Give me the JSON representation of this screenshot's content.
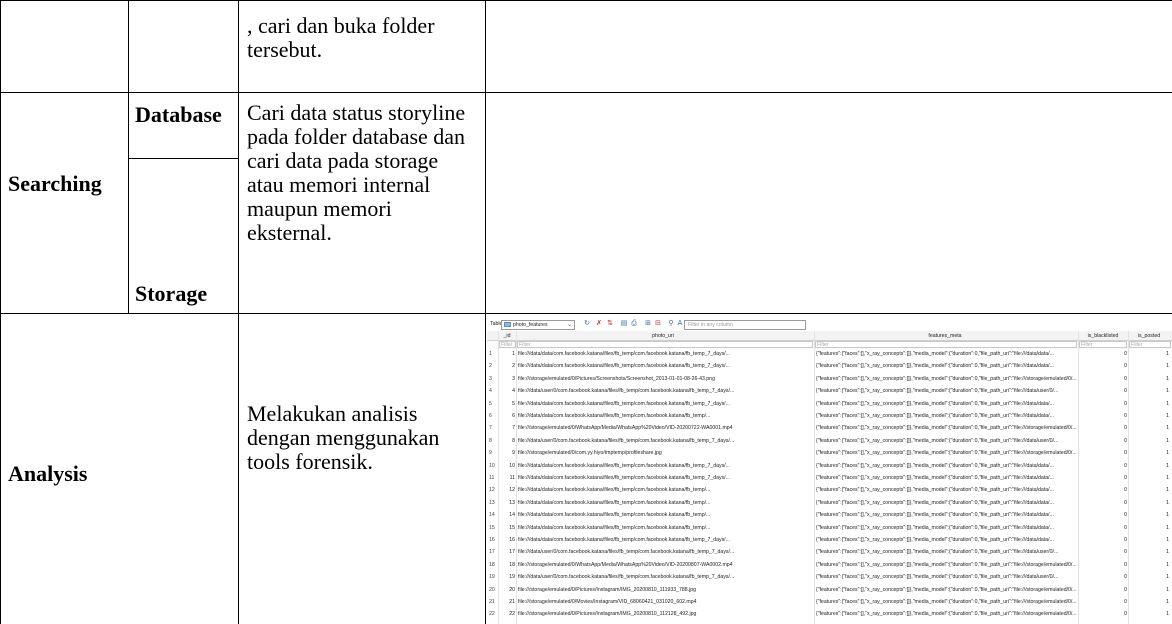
{
  "table": {
    "row1": {
      "col3": ", cari dan buka folder tersebut."
    },
    "row2": {
      "col1": "Searching",
      "sub_database": "Database",
      "sub_storage": "Storage",
      "col3": "Cari data status storyline pada folder database dan cari data pada storage atau memori internal maupun memori eksternal."
    },
    "row3": {
      "col1": "Analysis",
      "col3": "Melakukan analisis dengan menggunakan tools forensik."
    }
  },
  "screenshot": {
    "toolbar": {
      "table_label": "Table:",
      "table_name": "photo_features",
      "filter_placeholder": "Filter in any column"
    },
    "columns": [
      "_id",
      "photo_uri",
      "features_meta",
      "is_blacklisted",
      "is_posted"
    ],
    "filter_label": "Filter",
    "rows": [
      {
        "n": "1",
        "id": "1",
        "uri": "file:///data/data/com.facebook.katana/files/fb_temp/com.facebook.katana/fb_temp_7_days/...",
        "meta": "{\"features\":{\"faces\":[],\"x_ray_concepts\":[]},\"media_model\":{\"duration\":0,\"file_path_uri\":\"file:///data/data/...",
        "bl": "0",
        "po": "1"
      },
      {
        "n": "2",
        "id": "2",
        "uri": "file:///data/data/com.facebook.katana/files/fb_temp/com.facebook.katana/fb_temp_7_days/...",
        "meta": "{\"features\":{\"faces\":[],\"x_ray_concepts\":[]},\"media_model\":{\"duration\":0,\"file_path_uri\":\"file:///data/data/...",
        "bl": "0",
        "po": "1"
      },
      {
        "n": "3",
        "id": "3",
        "uri": "file:///storage/emulated/0/Pictures/Screenshots/Screenshot_2013-01-01-08-26-43.png",
        "meta": "{\"features\":{\"faces\":[],\"x_ray_concepts\":[]},\"media_model\":{\"duration\":0,\"file_path_uri\":\"file:///storage/emulated/0/...",
        "bl": "0",
        "po": "1"
      },
      {
        "n": "4",
        "id": "4",
        "uri": "file:///data/user/0/com.facebook.katana/files/fb_temp/com.facebook.katana/fb_temp_7_days/...",
        "meta": "{\"features\":{\"faces\":[],\"x_ray_concepts\":[]},\"media_model\":{\"duration\":0,\"file_path_uri\":\"file:///data/user/0/...",
        "bl": "0",
        "po": "1"
      },
      {
        "n": "5",
        "id": "5",
        "uri": "file:///data/data/com.facebook.katana/files/fb_temp/com.facebook.katana/fb_temp_7_days/...",
        "meta": "{\"features\":{\"faces\":[],\"x_ray_concepts\":[]},\"media_model\":{\"duration\":0,\"file_path_uri\":\"file:///data/data/...",
        "bl": "0",
        "po": "1"
      },
      {
        "n": "6",
        "id": "6",
        "uri": "file:///data/data/com.facebook.katana/files/fb_temp/com.facebook.katana/fb_temp/...",
        "meta": "{\"features\":{\"faces\":[],\"x_ray_concepts\":[]},\"media_model\":{\"duration\":0,\"file_path_uri\":\"file:///data/data/...",
        "bl": "0",
        "po": "1"
      },
      {
        "n": "7",
        "id": "7",
        "uri": "file:///storage/emulated/0/WhatsApp/Media/WhatsApp%20Video/VID-20200722-WA0001.mp4",
        "meta": "{\"features\":{\"faces\":[],\"x_ray_concepts\":[]},\"media_model\":{\"duration\":0,\"file_path_uri\":\"file:///storage/emulated/0/...",
        "bl": "0",
        "po": "1"
      },
      {
        "n": "8",
        "id": "8",
        "uri": "file:///data/user/0/com.facebook.katana/files/fb_temp/com.facebook.katana/fb_temp_7_days/...",
        "meta": "{\"features\":{\"faces\":[],\"x_ray_concepts\":[]},\"media_model\":{\"duration\":0,\"file_path_uri\":\"file:///data/user/0/...",
        "bl": "0",
        "po": "1"
      },
      {
        "n": "9",
        "id": "9",
        "uri": "file:///storage/emulated/0/com.yy.hiyo/tmptemp/profileshare.jpg",
        "meta": "{\"features\":{\"faces\":[],\"x_ray_concepts\":[]},\"media_model\":{\"duration\":0,\"file_path_uri\":\"file:///storage/emulated/0/...",
        "bl": "0",
        "po": "1"
      },
      {
        "n": "10",
        "id": "10",
        "uri": "file:///data/data/com.facebook.katana/files/fb_temp/com.facebook.katana/fb_temp_7_days/...",
        "meta": "{\"features\":{\"faces\":[],\"x_ray_concepts\":[]},\"media_model\":{\"duration\":0,\"file_path_uri\":\"file:///data/data/...",
        "bl": "0",
        "po": "1"
      },
      {
        "n": "11",
        "id": "11",
        "uri": "file:///data/data/com.facebook.katana/files/fb_temp/com.facebook.katana/fb_temp_7_days/...",
        "meta": "{\"features\":{\"faces\":[],\"x_ray_concepts\":[]},\"media_model\":{\"duration\":0,\"file_path_uri\":\"file:///data/data/...",
        "bl": "0",
        "po": "1"
      },
      {
        "n": "12",
        "id": "12",
        "uri": "file:///data/data/com.facebook.katana/files/fb_temp/com.facebook.katana/fb_temp/...",
        "meta": "{\"features\":{\"faces\":[],\"x_ray_concepts\":[]},\"media_model\":{\"duration\":0,\"file_path_uri\":\"file:///data/data/...",
        "bl": "0",
        "po": "1"
      },
      {
        "n": "13",
        "id": "13",
        "uri": "file:///data/data/com.facebook.katana/files/fb_temp/com.facebook.katana/fb_temp/...",
        "meta": "{\"features\":{\"faces\":[],\"x_ray_concepts\":[]},\"media_model\":{\"duration\":0,\"file_path_uri\":\"file:///data/data/...",
        "bl": "0",
        "po": "1"
      },
      {
        "n": "14",
        "id": "14",
        "uri": "file:///data/data/com.facebook.katana/files/fb_temp/com.facebook.katana/fb_temp/...",
        "meta": "{\"features\":{\"faces\":[],\"x_ray_concepts\":[]},\"media_model\":{\"duration\":0,\"file_path_uri\":\"file:///data/data/...",
        "bl": "0",
        "po": "1"
      },
      {
        "n": "15",
        "id": "15",
        "uri": "file:///data/data/com.facebook.katana/files/fb_temp/com.facebook.katana/fb_temp/...",
        "meta": "{\"features\":{\"faces\":[],\"x_ray_concepts\":[]},\"media_model\":{\"duration\":0,\"file_path_uri\":\"file:///data/data/...",
        "bl": "0",
        "po": "1"
      },
      {
        "n": "16",
        "id": "16",
        "uri": "file:///data/data/com.facebook.katana/files/fb_temp/com.facebook.katana/fb_temp_7_days/...",
        "meta": "{\"features\":{\"faces\":[],\"x_ray_concepts\":[]},\"media_model\":{\"duration\":0,\"file_path_uri\":\"file:///data/data/...",
        "bl": "0",
        "po": "1"
      },
      {
        "n": "17",
        "id": "17",
        "uri": "file:///data/user/0/com.facebook.katana/files/fb_temp/com.facebook.katana/fb_temp_7_days/...",
        "meta": "{\"features\":{\"faces\":[],\"x_ray_concepts\":[]},\"media_model\":{\"duration\":0,\"file_path_uri\":\"file:///data/user/0/...",
        "bl": "0",
        "po": "1"
      },
      {
        "n": "18",
        "id": "18",
        "uri": "file:///storage/emulated/0/WhatsApp/Media/WhatsApp%20Video/VID-20200807-WA0002.mp4",
        "meta": "{\"features\":{\"faces\":[],\"x_ray_concepts\":[]},\"media_model\":{\"duration\":0,\"file_path_uri\":\"file:///storage/emulated/0/...",
        "bl": "0",
        "po": "1"
      },
      {
        "n": "19",
        "id": "19",
        "uri": "file:///data/user/0/com.facebook.katana/files/fb_temp/com.facebook.katana/fb_temp_7_days/...",
        "meta": "{\"features\":{\"faces\":[],\"x_ray_concepts\":[]},\"media_model\":{\"duration\":0,\"file_path_uri\":\"file:///data/user/0/...",
        "bl": "0",
        "po": "1"
      },
      {
        "n": "20",
        "id": "20",
        "uri": "file:///storage/emulated/0/Pictures/Instagram/IMG_20200810_111933_788.jpg",
        "meta": "{\"features\":{\"faces\":[],\"x_ray_concepts\":[]},\"media_model\":{\"duration\":0,\"file_path_uri\":\"file:///storage/emulated/0/...",
        "bl": "0",
        "po": "1"
      },
      {
        "n": "21",
        "id": "21",
        "uri": "file:///storage/emulated/0/Movies/Instagram/VID_68060421_031020_602.mp4",
        "meta": "{\"features\":{\"faces\":[],\"x_ray_concepts\":[]},\"media_model\":{\"duration\":0,\"file_path_uri\":\"file:///storage/emulated/0/...",
        "bl": "0",
        "po": "1"
      },
      {
        "n": "22",
        "id": "22",
        "uri": "file:///storage/emulated/0/Pictures/Instagram/IMG_20200810_112128_492.jpg",
        "meta": "{\"features\":{\"faces\":[],\"x_ray_concepts\":[]},\"media_model\":{\"duration\":0,\"file_path_uri\":\"file:///storage/emulated/0/...",
        "bl": "0",
        "po": "1"
      }
    ]
  }
}
